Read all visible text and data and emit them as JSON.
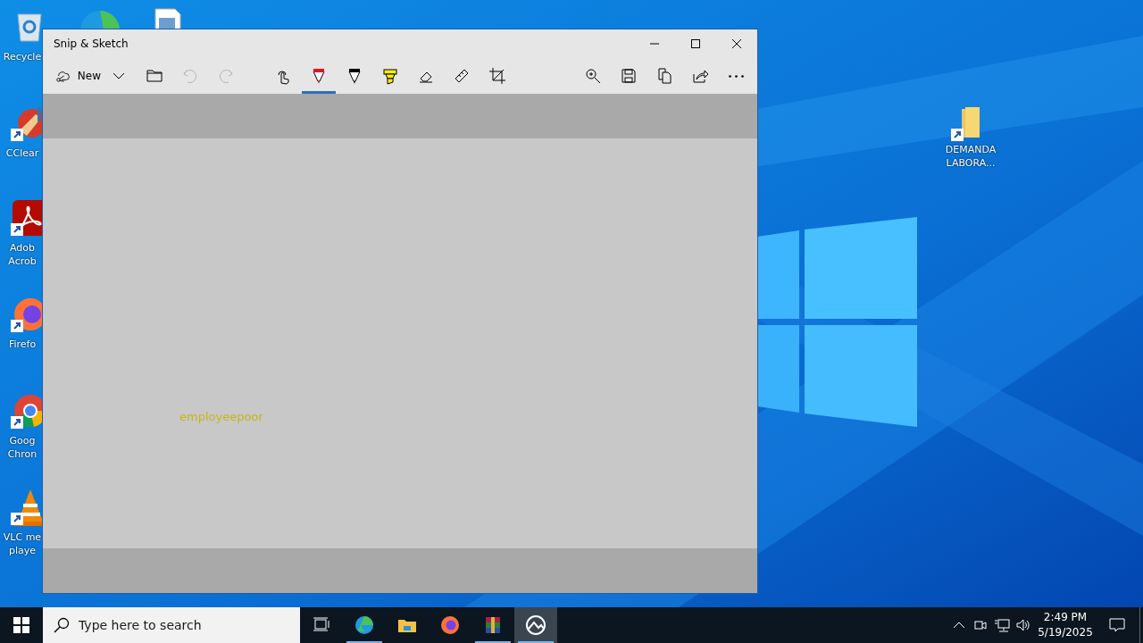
{
  "desktop_icons": [
    {
      "kind": "recycle-bin",
      "lines": [
        "Recycle"
      ]
    },
    {
      "kind": "ccleaner",
      "lines": [
        "CClear"
      ]
    },
    {
      "kind": "acrobat",
      "lines": [
        "Adob",
        "Acrob"
      ]
    },
    {
      "kind": "firefox",
      "lines": [
        "Firefo"
      ]
    },
    {
      "kind": "chrome",
      "lines": [
        "Goog",
        "Chron"
      ]
    },
    {
      "kind": "vlc",
      "lines": [
        "VLC me",
        "playe"
      ]
    },
    {
      "kind": "folder",
      "lines": [
        "DEMANDA",
        "LABORA..."
      ]
    }
  ],
  "window": {
    "title": "Snip & Sketch"
  },
  "toolbar": {
    "new_label": "New",
    "undo": {
      "disabled": true
    },
    "redo": {
      "disabled": true
    },
    "tools": [
      {
        "kind": "touch",
        "selected": false
      },
      {
        "kind": "pen",
        "selected": true,
        "color": "#e81123"
      },
      {
        "kind": "pencil",
        "selected": false,
        "color": "#000000"
      },
      {
        "kind": "highlighter",
        "selected": false,
        "color": "#ffee00"
      },
      {
        "kind": "eraser",
        "selected": false
      },
      {
        "kind": "ruler",
        "selected": false
      },
      {
        "kind": "crop",
        "selected": false
      }
    ]
  },
  "canvas": {
    "annotation": "employeepoor"
  },
  "taskbar": {
    "search": {
      "placeholder": "Type here to search"
    },
    "apps": [
      {
        "kind": "task-view",
        "running": false,
        "selected": false
      },
      {
        "kind": "edge",
        "running": true,
        "selected": false
      },
      {
        "kind": "explorer",
        "running": false,
        "selected": false
      },
      {
        "kind": "firefox",
        "running": false,
        "selected": false
      },
      {
        "kind": "winrar",
        "running": true,
        "selected": false
      },
      {
        "kind": "snip",
        "running": true,
        "selected": true
      }
    ],
    "time": "2:49 PM",
    "date": "5/19/2025"
  }
}
